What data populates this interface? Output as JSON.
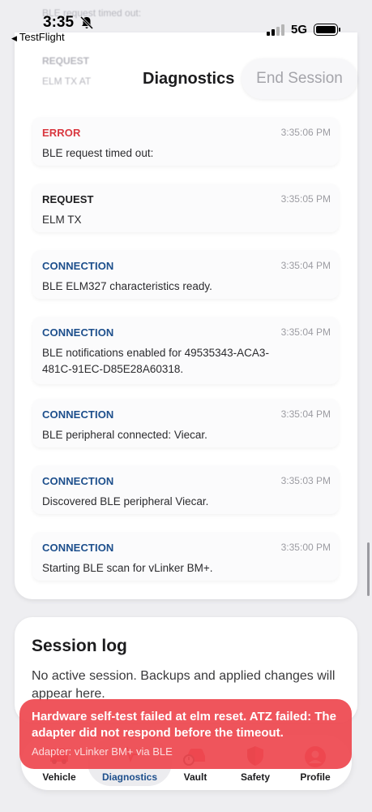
{
  "status_bar": {
    "time": "3:35",
    "back_app": "TestFlight",
    "network": "5G"
  },
  "header": {
    "ghost_lines": [
      "BLE request timed out:",
      "REQUEST",
      "ELM TX AT"
    ],
    "title": "Diagnostics",
    "end_session_label": "End Session"
  },
  "log": [
    {
      "type": "ERROR",
      "time": "3:35:06 PM",
      "message": "BLE request timed out:"
    },
    {
      "type": "REQUEST",
      "time": "3:35:05 PM",
      "message": "ELM TX"
    },
    {
      "type": "CONNECTION",
      "time": "3:35:04 PM",
      "message": "BLE ELM327 characteristics ready."
    },
    {
      "type": "CONNECTION",
      "time": "3:35:04 PM",
      "message": "BLE notifications enabled for 49535343-ACA3-481C-91EC-D85E28A60318."
    },
    {
      "type": "CONNECTION",
      "time": "3:35:04 PM",
      "message": "BLE peripheral connected: Viecar."
    },
    {
      "type": "CONNECTION",
      "time": "3:35:03 PM",
      "message": "Discovered BLE peripheral Viecar."
    },
    {
      "type": "CONNECTION",
      "time": "3:35:00 PM",
      "message": "Starting BLE scan for vLinker BM+."
    }
  ],
  "session_log": {
    "title": "Session log",
    "text": "No active session. Backups and applied changes will appear here."
  },
  "toast": {
    "message": "Hardware self-test failed at elm reset. ATZ failed: The adapter did not respond before the timeout.",
    "subtext": "Adapter: vLinker BM+ via BLE"
  },
  "tabs": [
    {
      "label": "Vehicle",
      "icon": "car-icon"
    },
    {
      "label": "Diagnostics",
      "icon": "waveform-icon"
    },
    {
      "label": "Vault",
      "icon": "vault-car-icon"
    },
    {
      "label": "Safety",
      "icon": "shield-icon"
    },
    {
      "label": "Profile",
      "icon": "person-icon"
    }
  ],
  "colors": {
    "error": "#d9373f",
    "connection": "#1d4f8c",
    "toast": "#ee4850",
    "active_tab": "#1d4f8c"
  }
}
